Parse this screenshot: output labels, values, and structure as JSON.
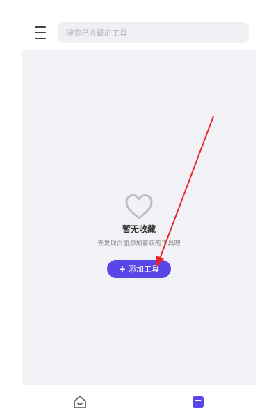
{
  "header": {
    "menu_icon": "menu-icon",
    "search": {
      "placeholder": "搜索已收藏的工具",
      "value": ""
    }
  },
  "empty_state": {
    "icon": "heart-outline-icon",
    "title": "暂无收藏",
    "description": "去发现页面添加喜欢的工具吧",
    "button_label": "添加工具",
    "button_icon": "+"
  },
  "bottom_nav": {
    "items": [
      {
        "icon": "home-icon",
        "active": false
      },
      {
        "icon": "favorites-icon",
        "active": true
      }
    ]
  },
  "colors": {
    "accent": "#5846e6",
    "panel_bg": "#f2f2f6",
    "search_bg": "#f0f0f4",
    "annotation_arrow": "#e8262a",
    "icon_muted": "#bfbfc6"
  }
}
